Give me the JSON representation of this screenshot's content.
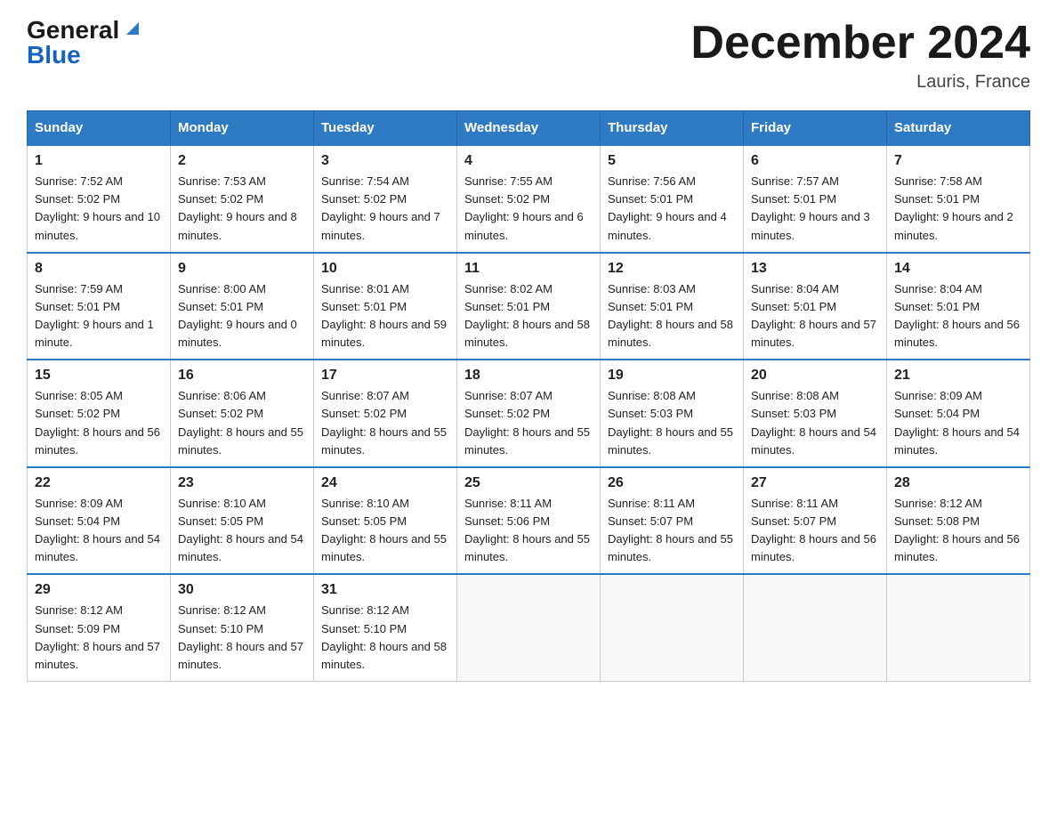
{
  "logo": {
    "general": "General",
    "blue": "Blue"
  },
  "header": {
    "month": "December 2024",
    "location": "Lauris, France"
  },
  "days_of_week": [
    "Sunday",
    "Monday",
    "Tuesday",
    "Wednesday",
    "Thursday",
    "Friday",
    "Saturday"
  ],
  "weeks": [
    [
      {
        "day": "1",
        "sunrise": "7:52 AM",
        "sunset": "5:02 PM",
        "daylight": "9 hours and 10 minutes."
      },
      {
        "day": "2",
        "sunrise": "7:53 AM",
        "sunset": "5:02 PM",
        "daylight": "9 hours and 8 minutes."
      },
      {
        "day": "3",
        "sunrise": "7:54 AM",
        "sunset": "5:02 PM",
        "daylight": "9 hours and 7 minutes."
      },
      {
        "day": "4",
        "sunrise": "7:55 AM",
        "sunset": "5:02 PM",
        "daylight": "9 hours and 6 minutes."
      },
      {
        "day": "5",
        "sunrise": "7:56 AM",
        "sunset": "5:01 PM",
        "daylight": "9 hours and 4 minutes."
      },
      {
        "day": "6",
        "sunrise": "7:57 AM",
        "sunset": "5:01 PM",
        "daylight": "9 hours and 3 minutes."
      },
      {
        "day": "7",
        "sunrise": "7:58 AM",
        "sunset": "5:01 PM",
        "daylight": "9 hours and 2 minutes."
      }
    ],
    [
      {
        "day": "8",
        "sunrise": "7:59 AM",
        "sunset": "5:01 PM",
        "daylight": "9 hours and 1 minute."
      },
      {
        "day": "9",
        "sunrise": "8:00 AM",
        "sunset": "5:01 PM",
        "daylight": "9 hours and 0 minutes."
      },
      {
        "day": "10",
        "sunrise": "8:01 AM",
        "sunset": "5:01 PM",
        "daylight": "8 hours and 59 minutes."
      },
      {
        "day": "11",
        "sunrise": "8:02 AM",
        "sunset": "5:01 PM",
        "daylight": "8 hours and 58 minutes."
      },
      {
        "day": "12",
        "sunrise": "8:03 AM",
        "sunset": "5:01 PM",
        "daylight": "8 hours and 58 minutes."
      },
      {
        "day": "13",
        "sunrise": "8:04 AM",
        "sunset": "5:01 PM",
        "daylight": "8 hours and 57 minutes."
      },
      {
        "day": "14",
        "sunrise": "8:04 AM",
        "sunset": "5:01 PM",
        "daylight": "8 hours and 56 minutes."
      }
    ],
    [
      {
        "day": "15",
        "sunrise": "8:05 AM",
        "sunset": "5:02 PM",
        "daylight": "8 hours and 56 minutes."
      },
      {
        "day": "16",
        "sunrise": "8:06 AM",
        "sunset": "5:02 PM",
        "daylight": "8 hours and 55 minutes."
      },
      {
        "day": "17",
        "sunrise": "8:07 AM",
        "sunset": "5:02 PM",
        "daylight": "8 hours and 55 minutes."
      },
      {
        "day": "18",
        "sunrise": "8:07 AM",
        "sunset": "5:02 PM",
        "daylight": "8 hours and 55 minutes."
      },
      {
        "day": "19",
        "sunrise": "8:08 AM",
        "sunset": "5:03 PM",
        "daylight": "8 hours and 55 minutes."
      },
      {
        "day": "20",
        "sunrise": "8:08 AM",
        "sunset": "5:03 PM",
        "daylight": "8 hours and 54 minutes."
      },
      {
        "day": "21",
        "sunrise": "8:09 AM",
        "sunset": "5:04 PM",
        "daylight": "8 hours and 54 minutes."
      }
    ],
    [
      {
        "day": "22",
        "sunrise": "8:09 AM",
        "sunset": "5:04 PM",
        "daylight": "8 hours and 54 minutes."
      },
      {
        "day": "23",
        "sunrise": "8:10 AM",
        "sunset": "5:05 PM",
        "daylight": "8 hours and 54 minutes."
      },
      {
        "day": "24",
        "sunrise": "8:10 AM",
        "sunset": "5:05 PM",
        "daylight": "8 hours and 55 minutes."
      },
      {
        "day": "25",
        "sunrise": "8:11 AM",
        "sunset": "5:06 PM",
        "daylight": "8 hours and 55 minutes."
      },
      {
        "day": "26",
        "sunrise": "8:11 AM",
        "sunset": "5:07 PM",
        "daylight": "8 hours and 55 minutes."
      },
      {
        "day": "27",
        "sunrise": "8:11 AM",
        "sunset": "5:07 PM",
        "daylight": "8 hours and 56 minutes."
      },
      {
        "day": "28",
        "sunrise": "8:12 AM",
        "sunset": "5:08 PM",
        "daylight": "8 hours and 56 minutes."
      }
    ],
    [
      {
        "day": "29",
        "sunrise": "8:12 AM",
        "sunset": "5:09 PM",
        "daylight": "8 hours and 57 minutes."
      },
      {
        "day": "30",
        "sunrise": "8:12 AM",
        "sunset": "5:10 PM",
        "daylight": "8 hours and 57 minutes."
      },
      {
        "day": "31",
        "sunrise": "8:12 AM",
        "sunset": "5:10 PM",
        "daylight": "8 hours and 58 minutes."
      },
      null,
      null,
      null,
      null
    ]
  ]
}
